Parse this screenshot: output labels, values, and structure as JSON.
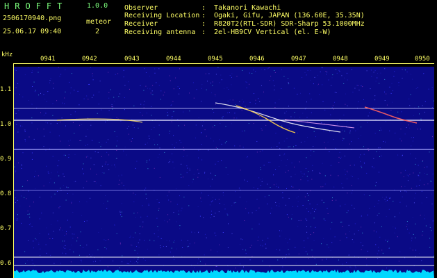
{
  "app": {
    "name": "HROFFT",
    "version": "1.0.0"
  },
  "file": {
    "name": "2506170940.png",
    "datetime": "25.06.17 09:40"
  },
  "meteor": {
    "label": "meteor",
    "count": "2"
  },
  "meta": [
    {
      "key": "Observer",
      "value": "Takanori Kawachi"
    },
    {
      "key": "Receiving Location",
      "value": "Ogaki, Gifu, JAPAN (136.60E, 35.35N)"
    },
    {
      "key": "Receiver",
      "value": "R820T2(RTL-SDR) SDR-Sharp 53.1000MHz"
    },
    {
      "key": "Receiving antenna",
      "value": "2el-HB9CV Vertical (el. E-W)"
    }
  ],
  "meta_colon": ":",
  "axis": {
    "unit": "kHz",
    "y_ticks": [
      "1.1",
      "1.0",
      "0.9",
      "0.8",
      "0.7",
      "0.6"
    ],
    "x_ticks": [
      "0941",
      "0942",
      "0943",
      "0944",
      "0945",
      "0946",
      "0947",
      "0948",
      "0949",
      "0950"
    ]
  },
  "colors": {
    "background": "#0a0a86",
    "text": "#ffff66",
    "title": "#7dff7d",
    "line": "#e6e6ff",
    "baseline": "#00d8ff"
  }
}
